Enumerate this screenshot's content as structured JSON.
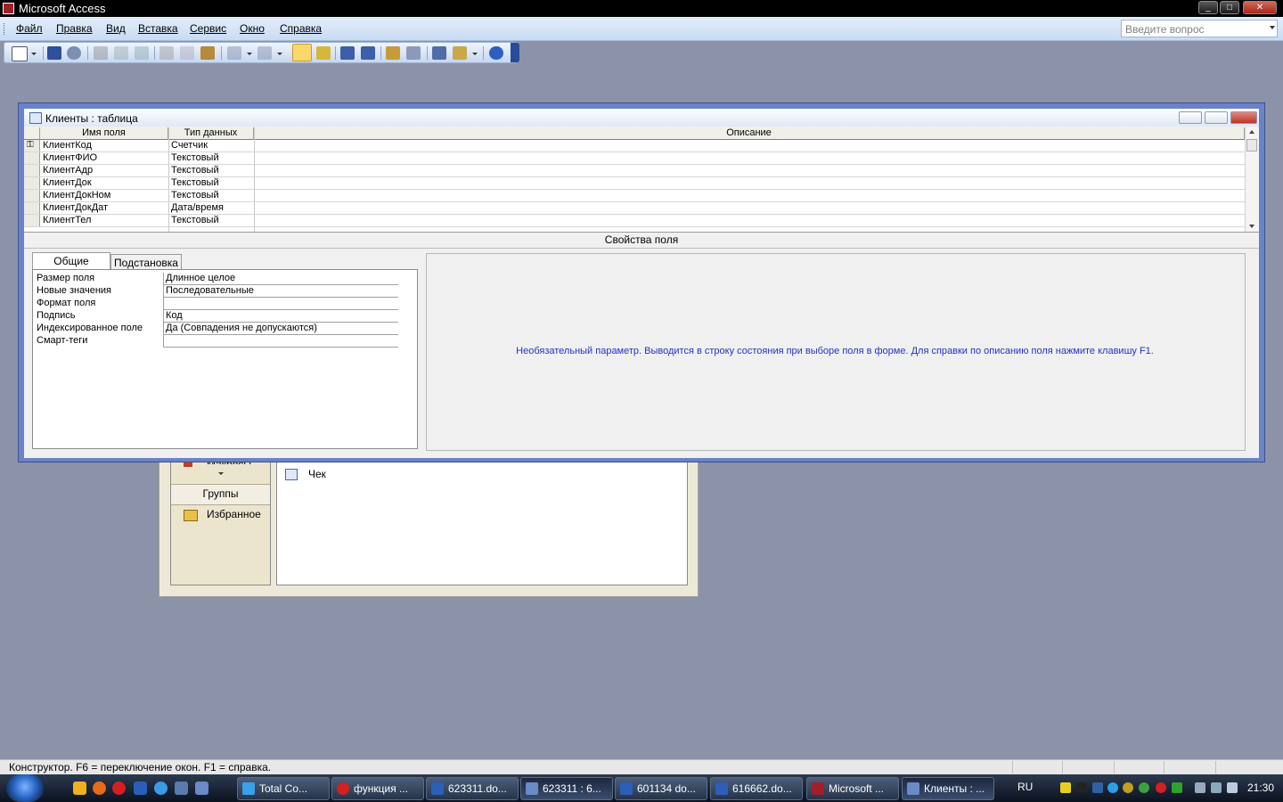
{
  "app": {
    "title": "Microsoft Access"
  },
  "menu": {
    "items": [
      "Файл",
      "Правка",
      "Вид",
      "Вставка",
      "Сервис",
      "Окно",
      "Справка"
    ],
    "ask_placeholder": "Введите вопрос"
  },
  "toolbar": {
    "buttons": [
      "view-icon",
      "save-icon",
      "search-icon",
      "print-icon",
      "print-preview-icon",
      "spelling-icon",
      "cut-icon",
      "copy-icon",
      "paste-icon",
      "undo-icon",
      "redo-icon",
      "primary-key-icon",
      "builder-icon",
      "insert-rows-icon",
      "delete-rows-icon",
      "properties-icon",
      "build-icon",
      "database-window-icon",
      "new-object-icon",
      "help-icon"
    ]
  },
  "table_window": {
    "title": "Клиенты : таблица",
    "columns": {
      "name": "Имя поля",
      "type": "Тип данных",
      "desc": "Описание"
    },
    "rows": [
      {
        "name": "КлиентКод",
        "type": "Счетчик"
      },
      {
        "name": "КлиентФИО",
        "type": "Текстовый"
      },
      {
        "name": "КлиентАдр",
        "type": "Текстовый"
      },
      {
        "name": "КлиентДок",
        "type": "Текстовый"
      },
      {
        "name": "КлиентДокНом",
        "type": "Текстовый"
      },
      {
        "name": "КлиентДокДат",
        "type": "Дата/время"
      },
      {
        "name": "КлиентТел",
        "type": "Текстовый"
      }
    ],
    "field_props_title": "Свойства поля",
    "tabs": {
      "general": "Общие",
      "lookup": "Подстановка"
    },
    "properties": [
      {
        "label": "Размер поля",
        "value": "Длинное целое"
      },
      {
        "label": "Новые значения",
        "value": "Последовательные"
      },
      {
        "label": "Формат поля",
        "value": ""
      },
      {
        "label": "Подпись",
        "value": "Код"
      },
      {
        "label": "Индексированное поле",
        "value": "Да (Совпадения не допускаются)"
      },
      {
        "label": "Смарт-теги",
        "value": ""
      }
    ],
    "help_text": "Необязательный параметр.  Выводится в строку состояния при выборе поля в форме.  Для справки по описанию поля нажмите клавишу F1."
  },
  "db_window": {
    "groups_label": "Группы",
    "favorites_label": "Избранное",
    "macros_label": "Макросы",
    "object_item": "Чек"
  },
  "statusbar": {
    "text": "Конструктор.  F6 = переключение окон.  F1 = справка."
  },
  "taskbar": {
    "tasks": [
      {
        "label": "Total Co...",
        "color": "#3aa0e8"
      },
      {
        "label": "функция ...",
        "color": "#d42020"
      },
      {
        "label": "623311.do...",
        "color": "#2b5fb8"
      },
      {
        "label": "623311 : 6...",
        "color": "#6a8ac8"
      },
      {
        "label": "601134 do...",
        "color": "#2b5fb8"
      },
      {
        "label": "616662.do...",
        "color": "#2b5fb8"
      },
      {
        "label": "Microsoft ...",
        "color": "#a0202a"
      },
      {
        "label": "Клиенты : ...",
        "color": "#6a8ac8"
      }
    ],
    "lang": "RU",
    "clock": "21:30"
  }
}
